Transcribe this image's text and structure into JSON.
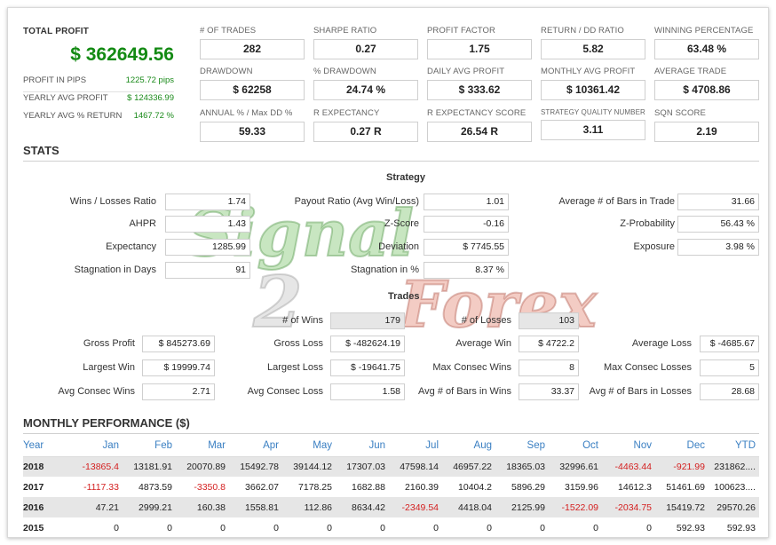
{
  "summary": {
    "total_profit_label": "TOTAL PROFIT",
    "total_profit_value": "$ 362649.56",
    "profit_pips_label": "PROFIT IN PIPS",
    "profit_pips_value": "1225.72 pips",
    "yearly_avg_profit_label": "YEARLY AVG PROFIT",
    "yearly_avg_profit_value": "$ 124336.99",
    "yearly_avg_return_label": "YEARLY AVG % RETURN",
    "yearly_avg_return_value": "1467.72 %"
  },
  "metrics": [
    {
      "label": "# OF TRADES",
      "value": "282"
    },
    {
      "label": "SHARPE RATIO",
      "value": "0.27"
    },
    {
      "label": "PROFIT FACTOR",
      "value": "1.75"
    },
    {
      "label": "RETURN / DD RATIO",
      "value": "5.82"
    },
    {
      "label": "WINNING PERCENTAGE",
      "value": "63.48 %"
    },
    {
      "label": "DRAWDOWN",
      "value": "$ 62258"
    },
    {
      "label": "% DRAWDOWN",
      "value": "24.74 %"
    },
    {
      "label": "DAILY AVG PROFIT",
      "value": "$ 333.62"
    },
    {
      "label": "MONTHLY AVG PROFIT",
      "value": "$ 10361.42"
    },
    {
      "label": "AVERAGE TRADE",
      "value": "$ 4708.86"
    },
    {
      "label": "ANNUAL % / Max DD %",
      "value": "59.33"
    },
    {
      "label": "R EXPECTANCY",
      "value": "0.27 R"
    },
    {
      "label": "R EXPECTANCY SCORE",
      "value": "26.54 R"
    },
    {
      "label": "STRATEGY QUALITY NUMBER",
      "value": "3.11"
    },
    {
      "label": "SQN SCORE",
      "value": "2.19"
    }
  ],
  "stats": {
    "title": "STATS",
    "strategy_heading": "Strategy",
    "trades_heading": "Trades",
    "strategy": [
      {
        "label": "Wins / Losses Ratio",
        "value": "1.74"
      },
      {
        "label": "Payout Ratio (Avg Win/Loss)",
        "value": "1.01"
      },
      {
        "label": "Average # of Bars in Trade",
        "value": "31.66"
      },
      {
        "label": "AHPR",
        "value": "1.43"
      },
      {
        "label": "Z-Score",
        "value": "-0.16"
      },
      {
        "label": "Z-Probability",
        "value": "56.43 %"
      },
      {
        "label": "Expectancy",
        "value": "1285.99"
      },
      {
        "label": "Deviation",
        "value": "$ 7745.55"
      },
      {
        "label": "Exposure",
        "value": "3.98 %"
      },
      {
        "label": "Stagnation in Days",
        "value": "91"
      },
      {
        "label": "Stagnation in %",
        "value": "8.37 %"
      }
    ],
    "trades_counts": [
      {
        "label": "# of Wins",
        "value": "179"
      },
      {
        "label": "# of Losses",
        "value": "103"
      }
    ],
    "trades": [
      {
        "label": "Gross Profit",
        "value": "$ 845273.69"
      },
      {
        "label": "Gross Loss",
        "value": "$ -482624.19"
      },
      {
        "label": "Average Win",
        "value": "$ 4722.2"
      },
      {
        "label": "Average Loss",
        "value": "$ -4685.67"
      },
      {
        "label": "Largest Win",
        "value": "$ 19999.74"
      },
      {
        "label": "Largest Loss",
        "value": "$ -19641.75"
      },
      {
        "label": "Max Consec Wins",
        "value": "8"
      },
      {
        "label": "Max Consec Losses",
        "value": "5"
      },
      {
        "label": "Avg Consec Wins",
        "value": "2.71"
      },
      {
        "label": "Avg Consec Loss",
        "value": "1.58"
      },
      {
        "label": "Avg # of Bars in Wins",
        "value": "33.37"
      },
      {
        "label": "Avg # of Bars in Losses",
        "value": "28.68"
      }
    ]
  },
  "monthly": {
    "title": "MONTHLY PERFORMANCE ($)",
    "headers": [
      "Year",
      "Jan",
      "Feb",
      "Mar",
      "Apr",
      "May",
      "Jun",
      "Jul",
      "Aug",
      "Sep",
      "Oct",
      "Nov",
      "Dec",
      "YTD"
    ],
    "rows": [
      [
        "2018",
        "-13865.4",
        "13181.91",
        "20070.89",
        "15492.78",
        "39144.12",
        "17307.03",
        "47598.14",
        "46957.22",
        "18365.03",
        "32996.61",
        "-4463.44",
        "-921.99",
        "231862...."
      ],
      [
        "2017",
        "-1117.33",
        "4873.59",
        "-3350.8",
        "3662.07",
        "7178.25",
        "1682.88",
        "2160.39",
        "10404.2",
        "5896.29",
        "3159.96",
        "14612.3",
        "51461.69",
        "100623...."
      ],
      [
        "2016",
        "47.21",
        "2999.21",
        "160.38",
        "1558.81",
        "112.86",
        "8634.42",
        "-2349.54",
        "4418.04",
        "2125.99",
        "-1522.09",
        "-2034.75",
        "15419.72",
        "29570.26"
      ],
      [
        "2015",
        "0",
        "0",
        "0",
        "0",
        "0",
        "0",
        "0",
        "0",
        "0",
        "0",
        "0",
        "592.93",
        "592.93"
      ]
    ],
    "negative_color": "#d42020",
    "header_color": "#3a7fc2"
  },
  "watermark": {
    "word1": "Signal",
    "word2": "2",
    "word3": "Forex"
  },
  "colors": {
    "profit_green": "#138a13",
    "stripe": "#e6e6e6"
  }
}
